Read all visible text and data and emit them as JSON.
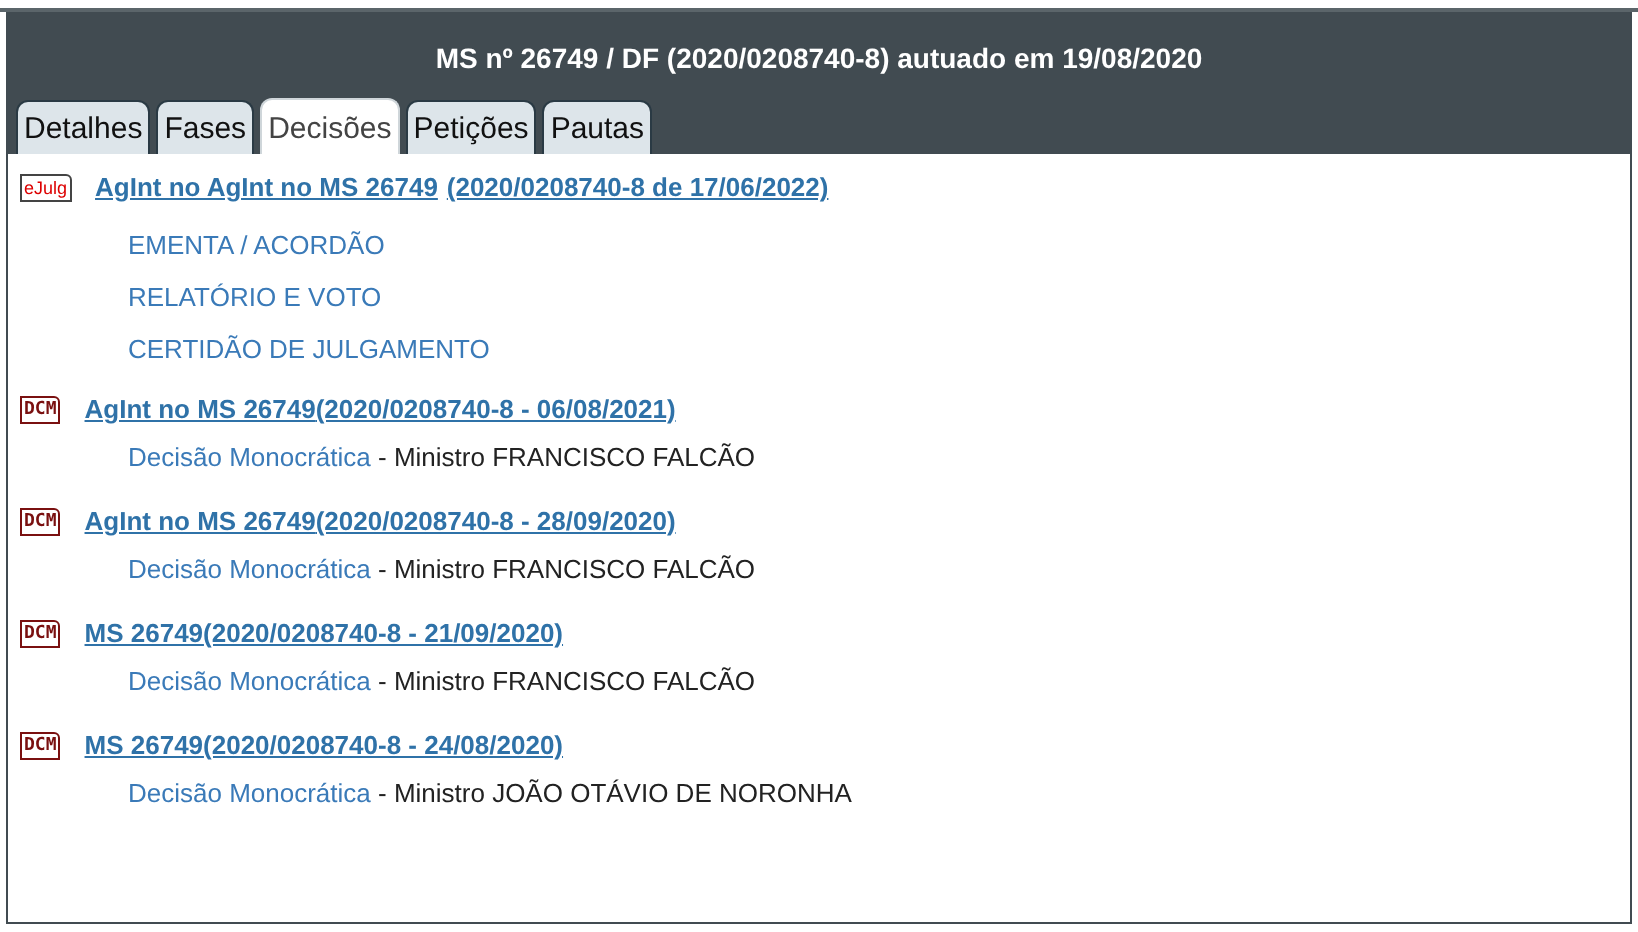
{
  "header": {
    "title": "MS nº 26749 / DF (2020/0208740-8) autuado em 19/08/2020"
  },
  "tabs": [
    {
      "label": "Detalhes",
      "selected": false
    },
    {
      "label": "Fases",
      "selected": false
    },
    {
      "label": "Decisões",
      "selected": true
    },
    {
      "label": "Petições",
      "selected": false
    },
    {
      "label": "Pautas",
      "selected": false
    }
  ],
  "decisions": [
    {
      "kind": "ejulg",
      "icon_text": "eJulg",
      "title": "AgInt no AgInt no MS 26749",
      "registry": "(2020/0208740-8 de 17/06/2022)",
      "documents": [
        "EMENTA / ACORDÃO",
        "RELATÓRIO E VOTO",
        "CERTIDÃO DE JULGAMENTO"
      ]
    },
    {
      "kind": "dcm",
      "icon_text": "DCM",
      "title": "AgInt no MS 26749",
      "registry": "(2020/0208740-8 - 06/08/2021)",
      "decision_type": "Decisão Monocrática",
      "minister": "- Ministro FRANCISCO FALCÃO"
    },
    {
      "kind": "dcm",
      "icon_text": "DCM",
      "title": "AgInt no MS 26749",
      "registry": "(2020/0208740-8 - 28/09/2020)",
      "decision_type": "Decisão Monocrática",
      "minister": "- Ministro FRANCISCO FALCÃO"
    },
    {
      "kind": "dcm",
      "icon_text": "DCM",
      "title": "MS 26749",
      "registry": "(2020/0208740-8 - 21/09/2020)",
      "decision_type": "Decisão Monocrática",
      "minister": "- Ministro FRANCISCO FALCÃO"
    },
    {
      "kind": "dcm",
      "icon_text": "DCM",
      "title": "MS 26749",
      "registry": "(2020/0208740-8 - 24/08/2020)",
      "decision_type": "Decisão Monocrática",
      "minister": "- Ministro JOÃO OTÁVIO DE NORONHA"
    }
  ]
}
